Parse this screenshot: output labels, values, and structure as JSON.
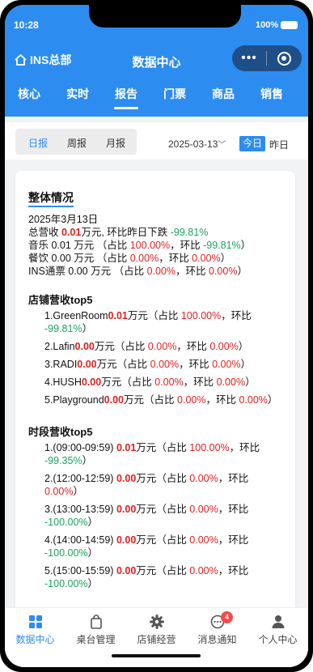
{
  "status": {
    "time": "10:28",
    "battery": "100%"
  },
  "header": {
    "home_label": "INS总部",
    "title": "数据中心",
    "tabs": [
      "核心",
      "实时",
      "报告",
      "门票",
      "商品",
      "销售"
    ],
    "active_tab": "报告"
  },
  "filter": {
    "periods": [
      "日报",
      "周报",
      "月报"
    ],
    "active_period": "日报",
    "date": "2025-03-13",
    "today_label": "今日",
    "yesterday_label": "昨日"
  },
  "overview": {
    "title": "整体情况",
    "date": "2025年3月13日",
    "total_prefix": "总营收 ",
    "total_value": "0.01",
    "total_suffix": "万元, 环比昨日下跌 ",
    "total_change": "-99.81%",
    "music_prefix": "音乐 0.01 万元  （占比 ",
    "music_share": "100.00%",
    "music_mid": "，环比 ",
    "music_change": "-99.81%",
    "music_end": "）",
    "food_prefix": "餐饮 0.00 万元  （占比 ",
    "food_share": "0.00%",
    "food_mid": "，环比 ",
    "food_change": "0.00%",
    "food_end": "）",
    "ins_prefix": "INS通票 0.00 万元  （占比 ",
    "ins_share": "0.00%",
    "ins_mid": "，环比 ",
    "ins_change": "0.00%",
    "ins_end": "）"
  },
  "top_stores": {
    "title": "店铺营收top5",
    "items": [
      {
        "name": "1.GreenRoom",
        "value": "0.01",
        "share": "100.00%",
        "change": "-99.81%"
      },
      {
        "name": "2.Lafin",
        "value": "0.00",
        "share": "0.00%",
        "change": "0.00%"
      },
      {
        "name": "3.RADI",
        "value": "0.00",
        "share": "0.00%",
        "change": "0.00%"
      },
      {
        "name": "4.HUSH",
        "value": "0.00",
        "share": "0.00%",
        "change": "0.00%"
      },
      {
        "name": "5.Playground",
        "value": "0.00",
        "share": "0.00%",
        "change": "0.00%"
      }
    ]
  },
  "top_times": {
    "title": "时段营收top5",
    "items": [
      {
        "name": "1.(09:00-09:59) ",
        "value": "0.01",
        "share": "100.00%",
        "change": "-99.35%"
      },
      {
        "name": "2.(12:00-12:59) ",
        "value": "0.00",
        "share": "0.00%",
        "change": "0.00%"
      },
      {
        "name": "3.(13:00-13:59) ",
        "value": "0.00",
        "share": "0.00%",
        "change": "-100.00%"
      },
      {
        "name": "4.(14:00-14:59) ",
        "value": "0.00",
        "share": "0.00%",
        "change": "-100.00%"
      },
      {
        "name": "5.(15:00-15:59) ",
        "value": "0.00",
        "share": "0.00%",
        "change": "-100.00%"
      }
    ]
  },
  "labels": {
    "unit": "万元",
    "share_prefix": "（占比 ",
    "change_mid": "，环比 ",
    "close": "）"
  },
  "bottom_nav": {
    "items": [
      "数据中心",
      "桌台管理",
      "店铺经营",
      "消息通知",
      "个人中心"
    ],
    "active": "数据中心",
    "message_badge": "4"
  },
  "colors": {
    "primary": "#2d8cf0",
    "negative": "#e02020",
    "positive": "#1aa35c"
  }
}
